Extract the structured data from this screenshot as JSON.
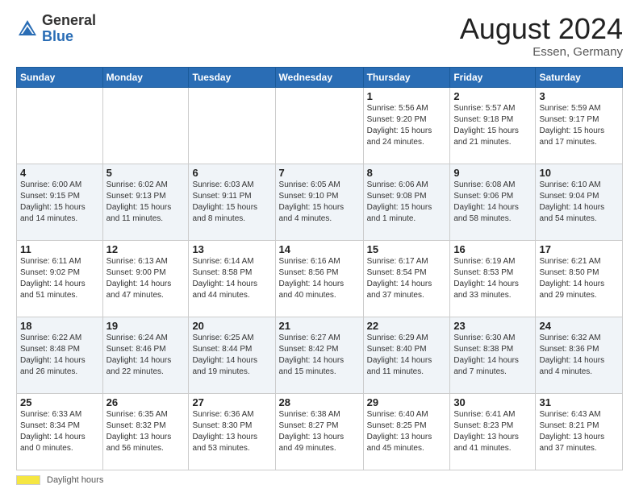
{
  "header": {
    "logo_general": "General",
    "logo_blue": "Blue",
    "month_year": "August 2024",
    "location": "Essen, Germany"
  },
  "footer": {
    "daylight_label": "Daylight hours"
  },
  "weekdays": [
    "Sunday",
    "Monday",
    "Tuesday",
    "Wednesday",
    "Thursday",
    "Friday",
    "Saturday"
  ],
  "weeks": [
    [
      {
        "day": "",
        "info": ""
      },
      {
        "day": "",
        "info": ""
      },
      {
        "day": "",
        "info": ""
      },
      {
        "day": "",
        "info": ""
      },
      {
        "day": "1",
        "info": "Sunrise: 5:56 AM\nSunset: 9:20 PM\nDaylight: 15 hours\nand 24 minutes."
      },
      {
        "day": "2",
        "info": "Sunrise: 5:57 AM\nSunset: 9:18 PM\nDaylight: 15 hours\nand 21 minutes."
      },
      {
        "day": "3",
        "info": "Sunrise: 5:59 AM\nSunset: 9:17 PM\nDaylight: 15 hours\nand 17 minutes."
      }
    ],
    [
      {
        "day": "4",
        "info": "Sunrise: 6:00 AM\nSunset: 9:15 PM\nDaylight: 15 hours\nand 14 minutes."
      },
      {
        "day": "5",
        "info": "Sunrise: 6:02 AM\nSunset: 9:13 PM\nDaylight: 15 hours\nand 11 minutes."
      },
      {
        "day": "6",
        "info": "Sunrise: 6:03 AM\nSunset: 9:11 PM\nDaylight: 15 hours\nand 8 minutes."
      },
      {
        "day": "7",
        "info": "Sunrise: 6:05 AM\nSunset: 9:10 PM\nDaylight: 15 hours\nand 4 minutes."
      },
      {
        "day": "8",
        "info": "Sunrise: 6:06 AM\nSunset: 9:08 PM\nDaylight: 15 hours\nand 1 minute."
      },
      {
        "day": "9",
        "info": "Sunrise: 6:08 AM\nSunset: 9:06 PM\nDaylight: 14 hours\nand 58 minutes."
      },
      {
        "day": "10",
        "info": "Sunrise: 6:10 AM\nSunset: 9:04 PM\nDaylight: 14 hours\nand 54 minutes."
      }
    ],
    [
      {
        "day": "11",
        "info": "Sunrise: 6:11 AM\nSunset: 9:02 PM\nDaylight: 14 hours\nand 51 minutes."
      },
      {
        "day": "12",
        "info": "Sunrise: 6:13 AM\nSunset: 9:00 PM\nDaylight: 14 hours\nand 47 minutes."
      },
      {
        "day": "13",
        "info": "Sunrise: 6:14 AM\nSunset: 8:58 PM\nDaylight: 14 hours\nand 44 minutes."
      },
      {
        "day": "14",
        "info": "Sunrise: 6:16 AM\nSunset: 8:56 PM\nDaylight: 14 hours\nand 40 minutes."
      },
      {
        "day": "15",
        "info": "Sunrise: 6:17 AM\nSunset: 8:54 PM\nDaylight: 14 hours\nand 37 minutes."
      },
      {
        "day": "16",
        "info": "Sunrise: 6:19 AM\nSunset: 8:53 PM\nDaylight: 14 hours\nand 33 minutes."
      },
      {
        "day": "17",
        "info": "Sunrise: 6:21 AM\nSunset: 8:50 PM\nDaylight: 14 hours\nand 29 minutes."
      }
    ],
    [
      {
        "day": "18",
        "info": "Sunrise: 6:22 AM\nSunset: 8:48 PM\nDaylight: 14 hours\nand 26 minutes."
      },
      {
        "day": "19",
        "info": "Sunrise: 6:24 AM\nSunset: 8:46 PM\nDaylight: 14 hours\nand 22 minutes."
      },
      {
        "day": "20",
        "info": "Sunrise: 6:25 AM\nSunset: 8:44 PM\nDaylight: 14 hours\nand 19 minutes."
      },
      {
        "day": "21",
        "info": "Sunrise: 6:27 AM\nSunset: 8:42 PM\nDaylight: 14 hours\nand 15 minutes."
      },
      {
        "day": "22",
        "info": "Sunrise: 6:29 AM\nSunset: 8:40 PM\nDaylight: 14 hours\nand 11 minutes."
      },
      {
        "day": "23",
        "info": "Sunrise: 6:30 AM\nSunset: 8:38 PM\nDaylight: 14 hours\nand 7 minutes."
      },
      {
        "day": "24",
        "info": "Sunrise: 6:32 AM\nSunset: 8:36 PM\nDaylight: 14 hours\nand 4 minutes."
      }
    ],
    [
      {
        "day": "25",
        "info": "Sunrise: 6:33 AM\nSunset: 8:34 PM\nDaylight: 14 hours\nand 0 minutes."
      },
      {
        "day": "26",
        "info": "Sunrise: 6:35 AM\nSunset: 8:32 PM\nDaylight: 13 hours\nand 56 minutes."
      },
      {
        "day": "27",
        "info": "Sunrise: 6:36 AM\nSunset: 8:30 PM\nDaylight: 13 hours\nand 53 minutes."
      },
      {
        "day": "28",
        "info": "Sunrise: 6:38 AM\nSunset: 8:27 PM\nDaylight: 13 hours\nand 49 minutes."
      },
      {
        "day": "29",
        "info": "Sunrise: 6:40 AM\nSunset: 8:25 PM\nDaylight: 13 hours\nand 45 minutes."
      },
      {
        "day": "30",
        "info": "Sunrise: 6:41 AM\nSunset: 8:23 PM\nDaylight: 13 hours\nand 41 minutes."
      },
      {
        "day": "31",
        "info": "Sunrise: 6:43 AM\nSunset: 8:21 PM\nDaylight: 13 hours\nand 37 minutes."
      }
    ]
  ]
}
